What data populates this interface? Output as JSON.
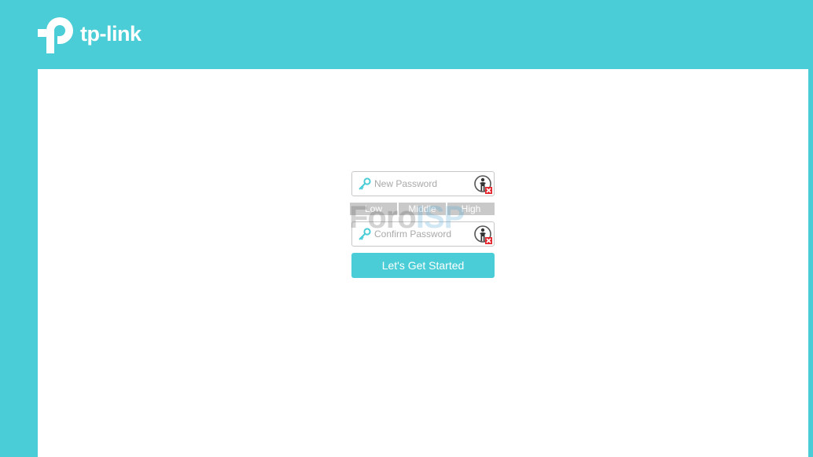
{
  "brand": {
    "logo_text": "tp-link",
    "color": "#4acdd6"
  },
  "form": {
    "new_password": {
      "value": "",
      "placeholder": "New Password",
      "icon": "key-icon",
      "toggle_icon": "show-password-icon"
    },
    "strength": {
      "labels": [
        "Low",
        "Middle",
        "High"
      ]
    },
    "confirm_password": {
      "value": "",
      "placeholder": "Confirm Password",
      "icon": "key-icon",
      "toggle_icon": "show-password-icon"
    },
    "submit_label": "Let's Get Started"
  },
  "watermark": {
    "part_a": "Foro",
    "part_b": "ISP"
  }
}
